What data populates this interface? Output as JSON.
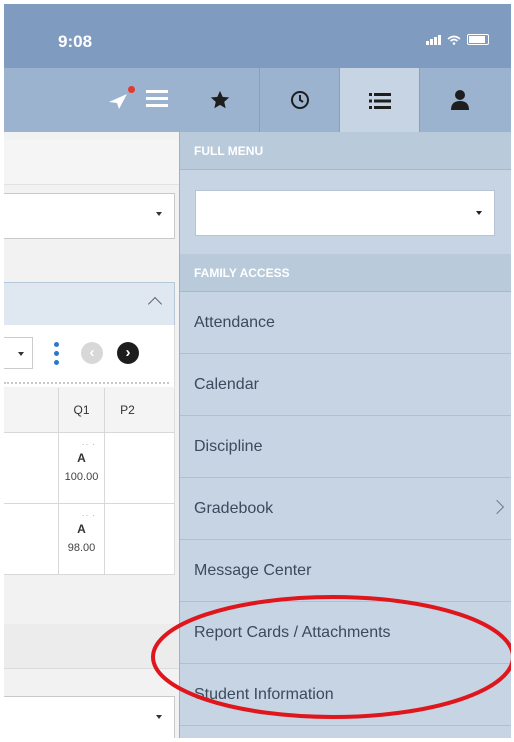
{
  "status_bar": {
    "time": "9:08"
  },
  "grades": {
    "columns": [
      "Q1",
      "P2"
    ],
    "rows": [
      {
        "q1_grade": "A",
        "q1_score": "100.00",
        "p2": ""
      },
      {
        "q1_grade": "A",
        "q1_score": "98.00",
        "p2": ""
      }
    ]
  },
  "sidebar": {
    "tabs": [
      {
        "icon": "star-icon",
        "active": false
      },
      {
        "icon": "clock-icon",
        "active": false
      },
      {
        "icon": "list-icon",
        "active": true
      },
      {
        "icon": "user-icon",
        "active": false
      }
    ],
    "full_menu_header": "FULL MENU",
    "menu_select_value": "",
    "section_header": "FAMILY ACCESS",
    "items": [
      {
        "label": "Attendance"
      },
      {
        "label": "Calendar"
      },
      {
        "label": "Discipline"
      },
      {
        "label": "Gradebook",
        "has_submenu": true
      },
      {
        "label": "Message Center"
      },
      {
        "label": "Report Cards / Attachments"
      },
      {
        "label": "Student Information"
      }
    ]
  },
  "colors": {
    "header": "#9cb3cf",
    "sidebar": "#c6d4e3",
    "highlight_circle": "#e0161d",
    "notification_dot": "#e23a2c"
  }
}
